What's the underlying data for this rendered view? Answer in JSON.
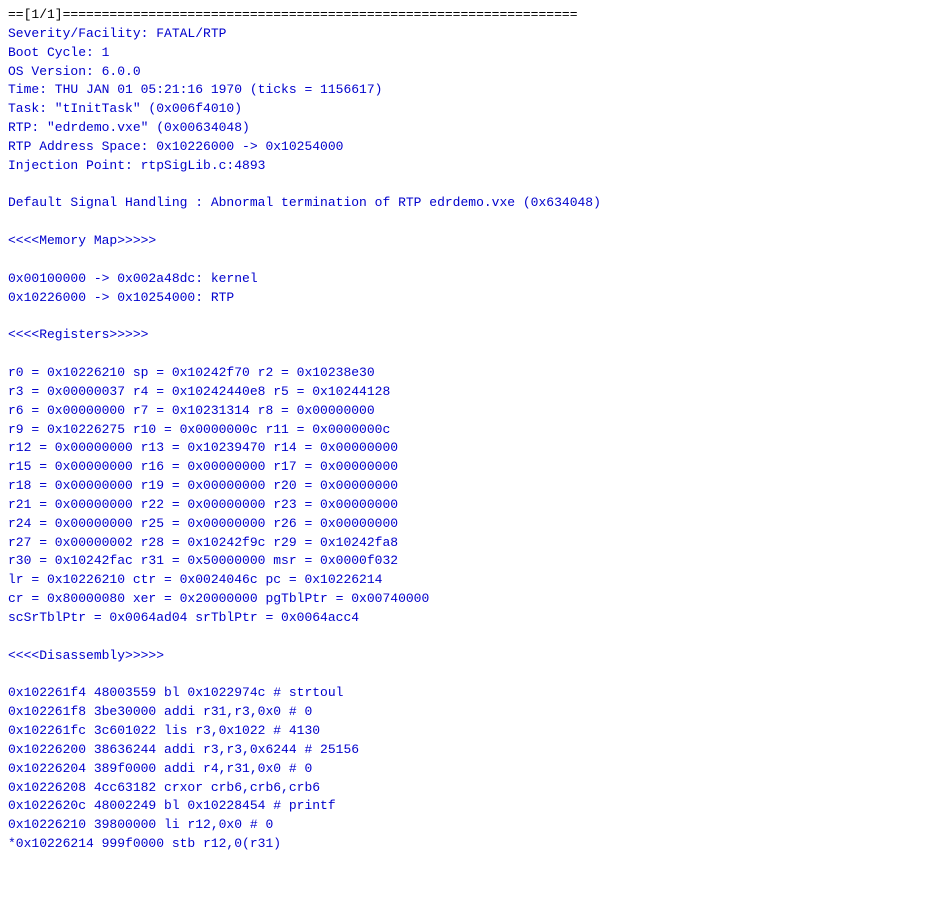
{
  "terminal": {
    "lines": [
      {
        "text": "==[1/1]==================================================================",
        "type": "separator"
      },
      {
        "text": "Severity/Facility: FATAL/RTP",
        "type": "normal"
      },
      {
        "text": "Boot Cycle: 1",
        "type": "normal"
      },
      {
        "text": "OS Version: 6.0.0",
        "type": "normal"
      },
      {
        "text": "Time: THU JAN 01 05:21:16 1970 (ticks = 1156617)",
        "type": "normal"
      },
      {
        "text": "Task: \"tInitTask\" (0x006f4010)",
        "type": "normal"
      },
      {
        "text": "RTP: \"edrdemo.vxe\" (0x00634048)",
        "type": "normal"
      },
      {
        "text": "RTP Address Space: 0x10226000 -> 0x10254000",
        "type": "normal"
      },
      {
        "text": "Injection Point: rtpSigLib.c:4893",
        "type": "normal"
      },
      {
        "text": "",
        "type": "empty"
      },
      {
        "text": "Default Signal Handling : Abnormal termination of RTP edrdemo.vxe (0x634048)",
        "type": "normal"
      },
      {
        "text": "",
        "type": "empty"
      },
      {
        "text": "<<<<Memory Map>>>>>",
        "type": "normal"
      },
      {
        "text": "",
        "type": "empty"
      },
      {
        "text": "0x00100000 -> 0x002a48dc: kernel",
        "type": "normal"
      },
      {
        "text": "0x10226000 -> 0x10254000: RTP",
        "type": "normal"
      },
      {
        "text": "",
        "type": "empty"
      },
      {
        "text": "<<<<Registers>>>>>",
        "type": "normal"
      },
      {
        "text": "",
        "type": "empty"
      },
      {
        "text": "r0 = 0x10226210 sp = 0x10242f70 r2 = 0x10238e30",
        "type": "normal"
      },
      {
        "text": "r3 = 0x00000037 r4 = 0x10242440e8 r5 = 0x10244128",
        "type": "normal"
      },
      {
        "text": "r6 = 0x00000000 r7 = 0x10231314 r8 = 0x00000000",
        "type": "normal"
      },
      {
        "text": "r9 = 0x10226275 r10 = 0x0000000c r11 = 0x0000000c",
        "type": "normal"
      },
      {
        "text": "r12 = 0x00000000 r13 = 0x10239470 r14 = 0x00000000",
        "type": "normal"
      },
      {
        "text": "r15 = 0x00000000 r16 = 0x00000000 r17 = 0x00000000",
        "type": "normal"
      },
      {
        "text": "r18 = 0x00000000 r19 = 0x00000000 r20 = 0x00000000",
        "type": "normal"
      },
      {
        "text": "r21 = 0x00000000 r22 = 0x00000000 r23 = 0x00000000",
        "type": "normal"
      },
      {
        "text": "r24 = 0x00000000 r25 = 0x00000000 r26 = 0x00000000",
        "type": "normal"
      },
      {
        "text": "r27 = 0x00000002 r28 = 0x10242f9c r29 = 0x10242fa8",
        "type": "normal"
      },
      {
        "text": "r30 = 0x10242fac r31 = 0x50000000 msr = 0x0000f032",
        "type": "normal"
      },
      {
        "text": "lr = 0x10226210 ctr = 0x0024046c pc = 0x10226214",
        "type": "normal"
      },
      {
        "text": "cr = 0x80000080 xer = 0x20000000 pgTblPtr = 0x00740000",
        "type": "normal"
      },
      {
        "text": "scSrTblPtr = 0x0064ad04 srTblPtr = 0x0064acc4",
        "type": "normal"
      },
      {
        "text": "",
        "type": "empty"
      },
      {
        "text": "<<<<Disassembly>>>>>",
        "type": "normal"
      },
      {
        "text": "",
        "type": "empty"
      },
      {
        "text": "0x102261f4 48003559 bl 0x1022974c # strtoul",
        "type": "normal"
      },
      {
        "text": "0x102261f8 3be30000 addi r31,r3,0x0 # 0",
        "type": "normal"
      },
      {
        "text": "0x102261fc 3c601022 lis r3,0x1022 # 4130",
        "type": "normal"
      },
      {
        "text": "0x10226200 38636244 addi r3,r3,0x6244 # 25156",
        "type": "normal"
      },
      {
        "text": "0x10226204 389f0000 addi r4,r31,0x0 # 0",
        "type": "normal"
      },
      {
        "text": "0x10226208 4cc63182 crxor crb6,crb6,crb6",
        "type": "normal"
      },
      {
        "text": "0x1022620c 48002249 bl 0x10228454 # printf",
        "type": "normal"
      },
      {
        "text": "0x10226210 39800000 li r12,0x0 # 0",
        "type": "normal"
      },
      {
        "text": "*0x10226214 999f0000 stb r12,0(r31)",
        "type": "normal"
      }
    ]
  }
}
